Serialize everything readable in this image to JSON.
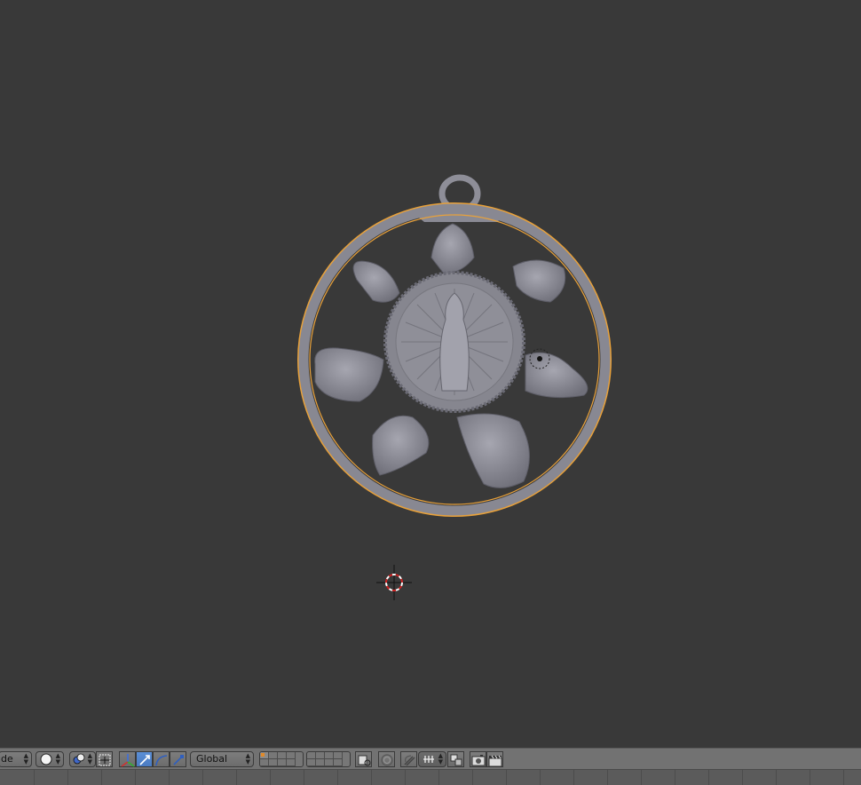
{
  "header": {
    "mode_label": "de",
    "transform_orientation": "Global"
  },
  "icons": {
    "pivot": "pivot-point-icon",
    "manipulator": "manipulator-axes-icon",
    "translate": "translate-icon",
    "rotate": "rotate-icon",
    "scale": "scale-icon",
    "render_preview": "render-icon",
    "clapper": "clapperboard-icon"
  },
  "colors": {
    "viewport_bg": "#393939",
    "header_bg": "#727272",
    "selection_outline": "#e8a13a",
    "active_blue": "#5b8fd6",
    "object_gray": "#8c8c96"
  }
}
